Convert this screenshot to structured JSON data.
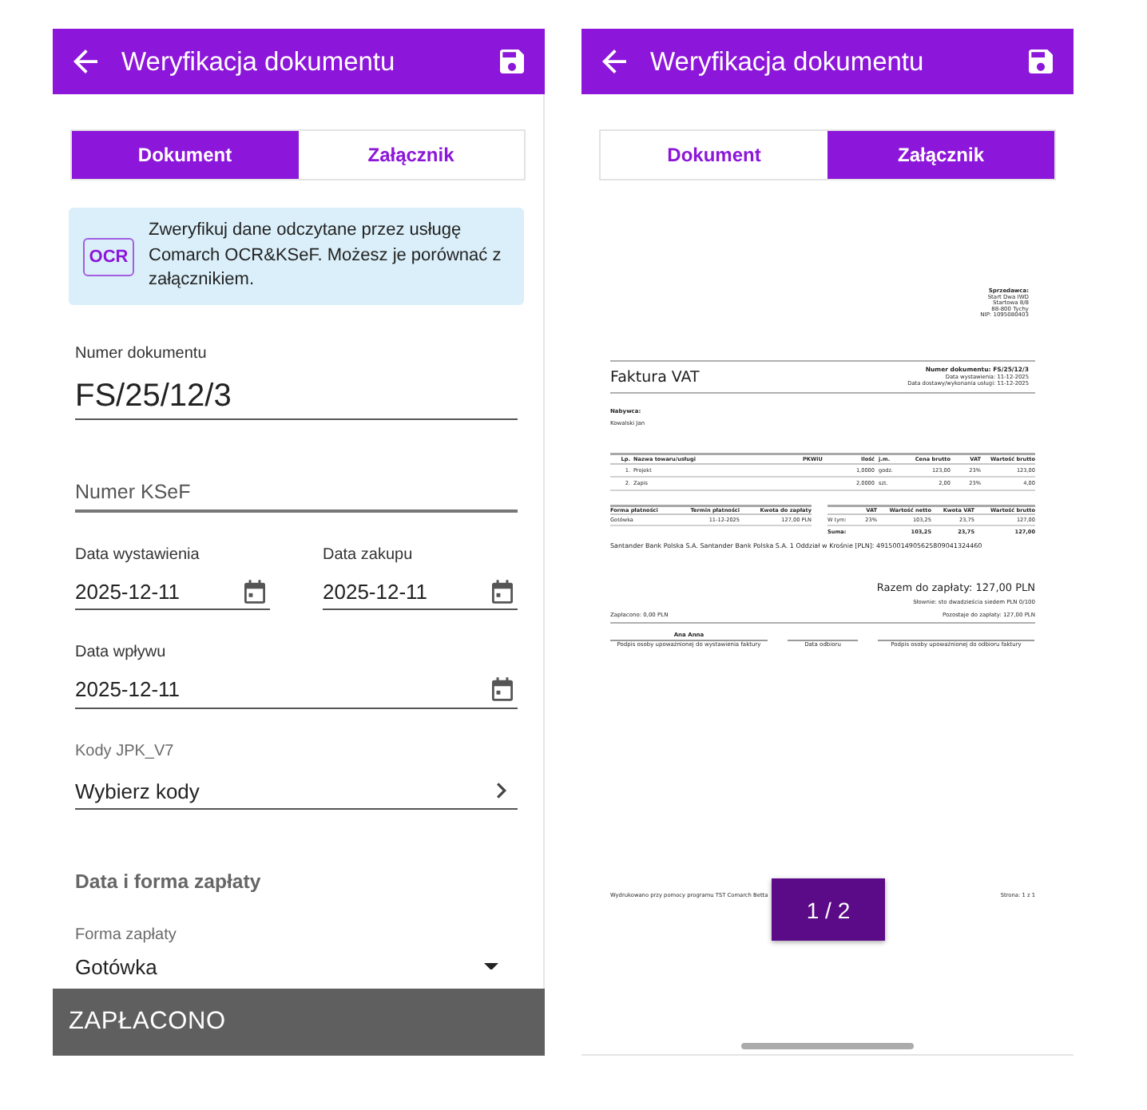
{
  "screens": [
    {
      "kind": "form",
      "app_bar": {
        "title": "Weryfikacja dokumentu"
      },
      "tabs": [
        {
          "label": "Dokument",
          "selected": true
        },
        {
          "label": "Załącznik",
          "selected": false
        }
      ],
      "info_banner": {
        "badge": "OCR",
        "text": "Zweryfikuj dane odczytane przez usługę Comarch OCR&KSeF. Możesz je porównać z załącznikiem."
      },
      "fields": [
        {
          "kind": "text",
          "label": "Numer dokumentu",
          "value": "FS/25/12/3"
        },
        {
          "kind": "text",
          "placeholder": "Numer KSeF"
        },
        {
          "kind": "date_row",
          "items": [
            {
              "label": "Data wystawienia",
              "value": "2025-12-11"
            },
            {
              "label": "Data zakupu",
              "value": "2025-12-11"
            }
          ]
        },
        {
          "kind": "date_row",
          "items": [
            {
              "label": "Data wpływu",
              "value": "2025-12-11"
            }
          ]
        },
        {
          "kind": "picker",
          "label": "Kody JPK_V7",
          "value": "Wybierz kody"
        },
        {
          "kind": "section",
          "title": "Data i forma zapłaty"
        },
        {
          "kind": "dropdown",
          "label": "Forma zapłaty",
          "value": "Gotówka"
        }
      ],
      "bottom_bar": {
        "label": "ZAPŁACONO"
      }
    },
    {
      "kind": "attachment",
      "app_bar": {
        "title": "Weryfikacja dokumentu"
      },
      "tabs": [
        {
          "label": "Dokument",
          "selected": false
        },
        {
          "label": "Załącznik",
          "selected": true
        }
      ],
      "document": {
        "seller": {
          "heading": "Sprzedawca:",
          "lines": [
            "Start Dwa IWD",
            "Startowa 8/8",
            "88-800 Tychy",
            "NIP: 1095080403"
          ]
        },
        "title": "Faktura VAT",
        "number": "Numer dokumentu: FS/25/12/3",
        "dates": [
          "Data wystawienia: 11-12-2025",
          "Data dostawy/wykonania usługi: 11-12-2025"
        ],
        "buyer": {
          "heading": "Nabywca:",
          "name": "Kowalski Jan"
        },
        "items_table": {
          "columns": [
            "Lp.",
            "Nazwa towaru/usługi",
            "PKWiU",
            "Ilość",
            "j.m.",
            "Cena brutto",
            "VAT",
            "Wartość brutto"
          ],
          "rows": [
            [
              "1.",
              "Projekt",
              null,
              "1,0000",
              "godz.",
              "123,00",
              "23%",
              "123,00"
            ],
            [
              "2.",
              "Zapis",
              null,
              "2,0000",
              "szt.",
              "2,00",
              "23%",
              "4,00"
            ]
          ]
        },
        "payment_table": {
          "columns": [
            "Forma płatności",
            "Termin płatności",
            "Kwota do zapłaty"
          ],
          "rows": [
            [
              "Gotówka",
              "11-12-2025",
              "127,00 PLN"
            ]
          ]
        },
        "vat_table": {
          "columns": [
            null,
            "VAT",
            "Wartość netto",
            "Kwota VAT",
            "Wartość brutto"
          ],
          "rows": [
            {
              "cells": [
                "W tym:",
                "23%",
                "103,25",
                "23,75",
                "127,00"
              ],
              "total": false
            },
            {
              "cells": [
                "Suma:",
                null,
                "103,25",
                "23,75",
                "127,00"
              ],
              "total": true
            }
          ]
        },
        "bank_account": "Santander Bank Polska S.A. Santander Bank Polska S.A. 1 Oddział w Krośnie [PLN]: 49150014905625809041324460",
        "amount_due": "Razem do zapłaty: 127,00 PLN",
        "amount_in_words": "Słownie: sto dwadzieścia siedem PLN 0/100",
        "paid": "Zapłacono: 0,00 PLN",
        "remaining": "Pozostaje do zapłaty: 127,00 PLN",
        "signatures": [
          {
            "name": "Ana Anna",
            "caption": "Podpis osoby upoważnionej do wystawienia faktury"
          },
          {
            "caption": "Data odbioru"
          },
          {
            "caption": "Podpis osoby upoważnionej do odbioru faktury"
          }
        ],
        "footer": {
          "printed_by": "Wydrukowano przy pomocy programu TST Comarch Betta",
          "page": "Strona: 1 z 1"
        }
      },
      "page_indicator": "1 / 2"
    }
  ]
}
